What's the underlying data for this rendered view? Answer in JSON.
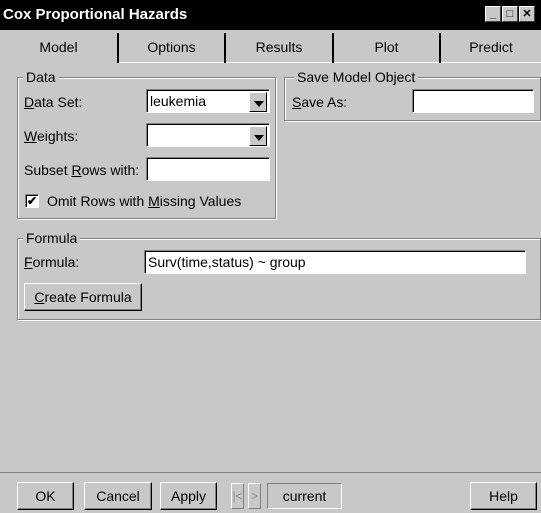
{
  "window": {
    "title": "Cox Proportional Hazards",
    "controls": {
      "minimize": "_",
      "maximize": "□",
      "close": "✕"
    }
  },
  "tabs": [
    {
      "label": "Model",
      "active": true
    },
    {
      "label": "Options",
      "active": false
    },
    {
      "label": "Results",
      "active": false
    },
    {
      "label": "Plot",
      "active": false
    },
    {
      "label": "Predict",
      "active": false
    }
  ],
  "data_group": {
    "title": "Data",
    "dataset": {
      "label_u": "D",
      "label_rest": "ata Set:",
      "value": "leukemia"
    },
    "weights": {
      "label_u": "W",
      "label_rest": "eights:",
      "value": ""
    },
    "subset": {
      "label_pre": "Subset ",
      "label_u": "R",
      "label_rest": "ows with:",
      "value": ""
    },
    "omit": {
      "label_pre": "Omit Rows with ",
      "label_u": "M",
      "label_rest": "issing Values",
      "checked": true,
      "mark": "✔"
    }
  },
  "save_group": {
    "title": "Save Model Object",
    "save_as": {
      "label_u": "S",
      "label_rest": "ave As:",
      "value": ""
    }
  },
  "formula_group": {
    "title": "Formula",
    "formula": {
      "label_u": "F",
      "label_rest": "ormula:",
      "value": "Surv(time,status) ~ group"
    },
    "create_button": {
      "label_u": "C",
      "label_rest": "reate Formula"
    }
  },
  "footer": {
    "ok": "OK",
    "cancel": "Cancel",
    "apply": "Apply",
    "prev": "|<",
    "next": ">",
    "current": "current",
    "help": "Help"
  }
}
